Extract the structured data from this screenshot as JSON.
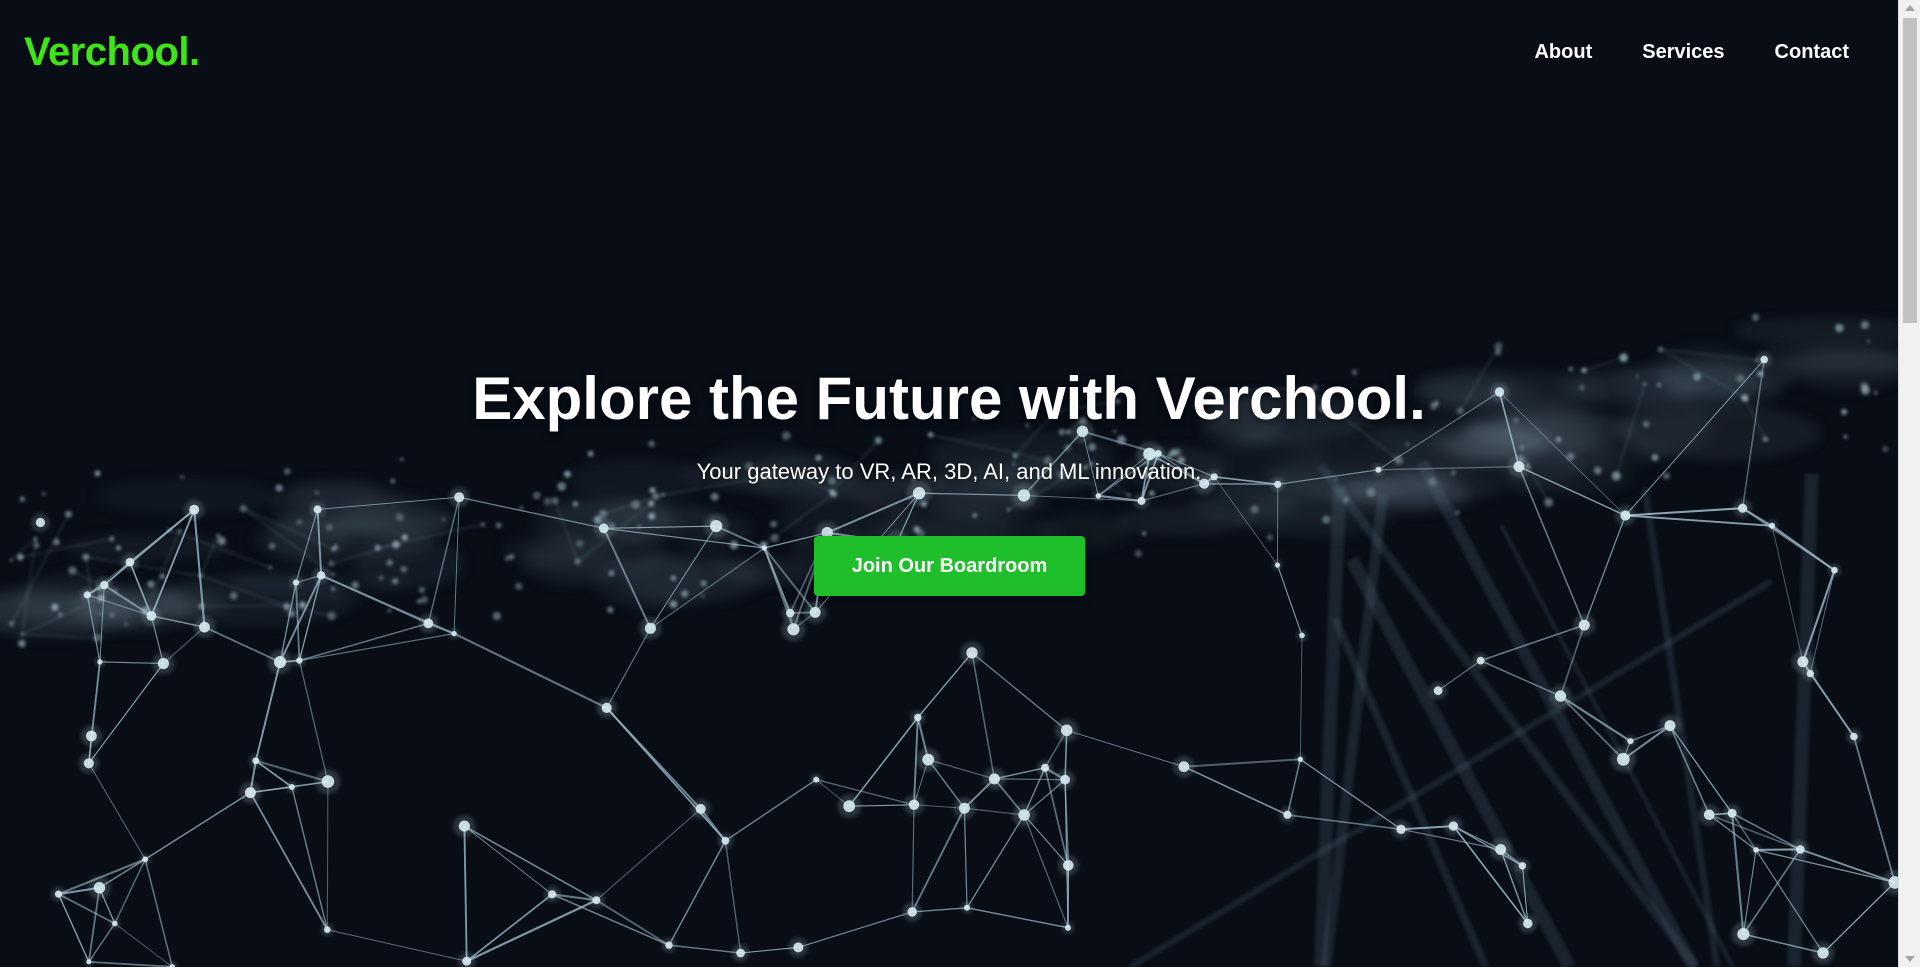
{
  "brand": {
    "logo_text": "Verchool.",
    "accent_color": "#3fe617"
  },
  "nav": {
    "items": [
      {
        "label": "About"
      },
      {
        "label": "Services"
      },
      {
        "label": "Contact"
      }
    ]
  },
  "hero": {
    "title": "Explore the Future with Verchool.",
    "subtitle": "Your gateway to VR, AR, 3D, AI, and ML innovation.",
    "cta_label": "Join Our Boardroom",
    "cta_color": "#1fbf2b",
    "background_color": "#080d16",
    "background_image": "network-mesh"
  }
}
